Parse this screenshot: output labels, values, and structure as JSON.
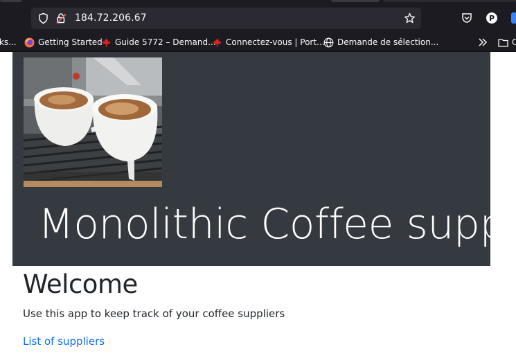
{
  "browser": {
    "url": "184.72.206.67",
    "bookmarks": [
      {
        "label": "rks...",
        "icon": "bookmark-folder-icon"
      },
      {
        "label": "Getting Started",
        "icon": "firefox-icon"
      },
      {
        "label": "Guide 5772 – Demand...",
        "icon": "maple-leaf-icon"
      },
      {
        "label": "Connectez-vous | Port...",
        "icon": "maple-leaf-icon"
      },
      {
        "label": "Demande de sélection...",
        "icon": "globe-icon"
      },
      {
        "label": "O",
        "icon": "folder-icon"
      }
    ]
  },
  "hero": {
    "title": "Monolithic Coffee supp",
    "image": "espresso-cups-image"
  },
  "main": {
    "heading": "Welcome",
    "lead": "Use this app to keep track of your coffee suppliers",
    "link_label": "List of suppliers"
  },
  "colors": {
    "hero_bg": "#343a40",
    "link": "#0d6efd",
    "chrome_bg": "#1c1b22",
    "urlbar_bg": "#2b2a33"
  }
}
